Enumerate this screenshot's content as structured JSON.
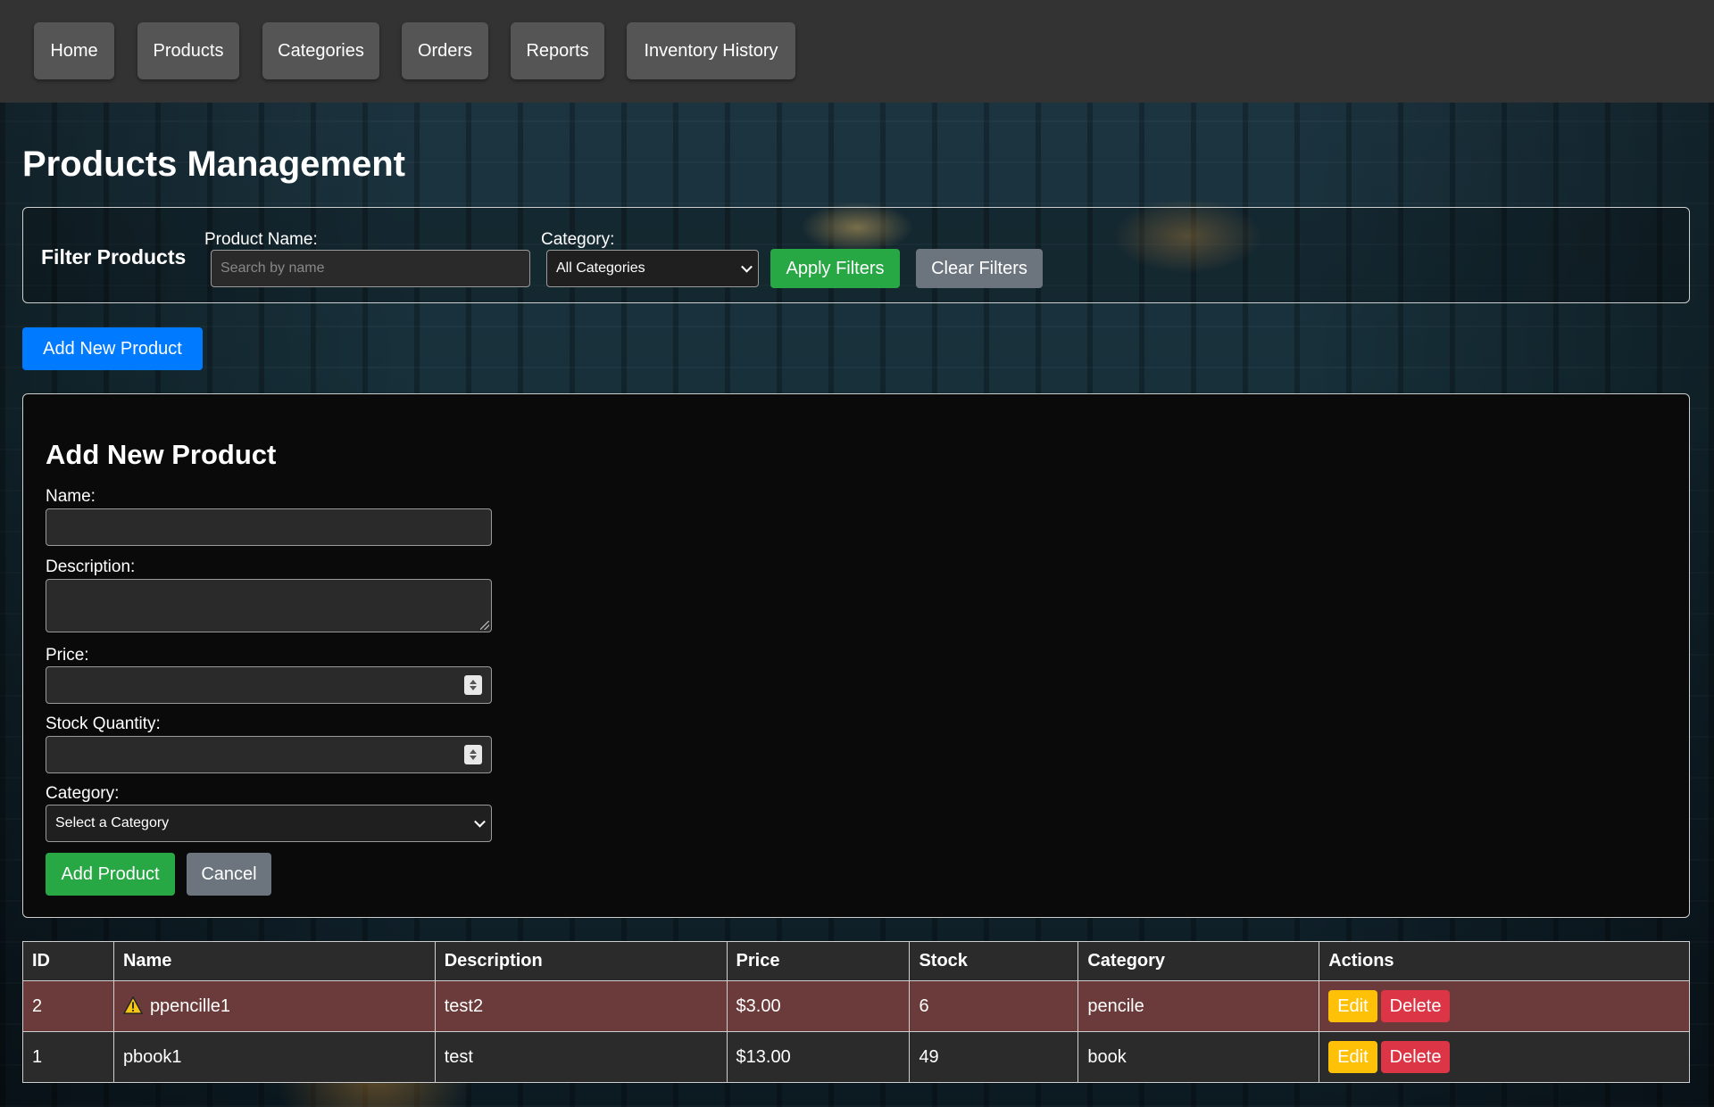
{
  "nav": {
    "items": [
      {
        "label": "Home"
      },
      {
        "label": "Products"
      },
      {
        "label": "Categories"
      },
      {
        "label": "Orders"
      },
      {
        "label": "Reports"
      },
      {
        "label": "Inventory History"
      }
    ]
  },
  "page": {
    "title": "Products Management"
  },
  "filter": {
    "title": "Filter Products",
    "name_label": "Product Name:",
    "name_placeholder": "Search by name",
    "category_label": "Category:",
    "category_selected": "All Categories",
    "apply_label": "Apply Filters",
    "clear_label": "Clear Filters"
  },
  "add_button_label": "Add New Product",
  "form": {
    "title": "Add New Product",
    "name_label": "Name:",
    "description_label": "Description:",
    "price_label": "Price:",
    "stock_label": "Stock Quantity:",
    "category_label": "Category:",
    "category_selected": "Select a Category",
    "submit_label": "Add Product",
    "cancel_label": "Cancel"
  },
  "table": {
    "headers": [
      "ID",
      "Name",
      "Description",
      "Price",
      "Stock",
      "Category",
      "Actions"
    ],
    "rows": [
      {
        "id": "2",
        "name": "ppencille1",
        "description": "test2",
        "price": "$3.00",
        "stock": "6",
        "category": "pencile",
        "low_stock": true
      },
      {
        "id": "1",
        "name": "pbook1",
        "description": "test",
        "price": "$13.00",
        "stock": "49",
        "category": "book",
        "low_stock": false
      }
    ],
    "edit_label": "Edit",
    "delete_label": "Delete"
  },
  "colors": {
    "nav_bg": "#333333",
    "nav_button": "#555555",
    "primary": "#007bff",
    "success": "#28a745",
    "secondary": "#6c757d",
    "warning": "#ffc107",
    "danger": "#dc3545",
    "low_stock_row": "#6b3a3a"
  }
}
